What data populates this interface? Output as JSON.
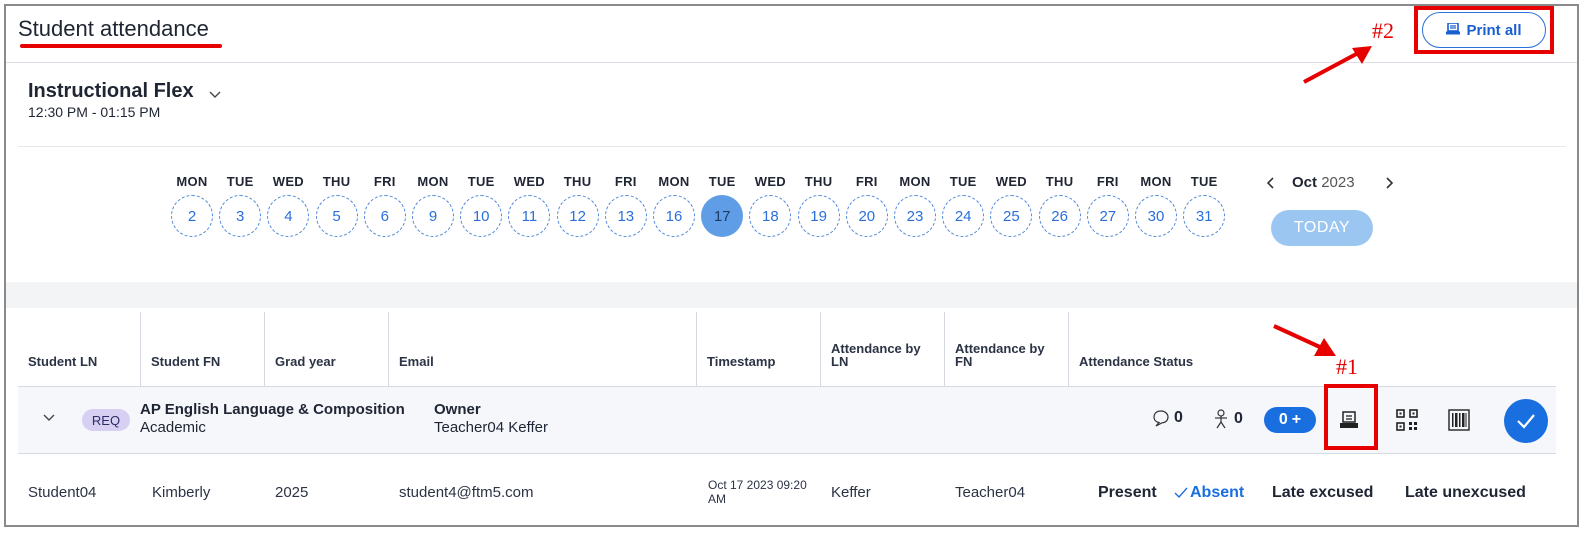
{
  "header": {
    "title": "Student attendance",
    "print_all_label": "Print all"
  },
  "annotations": {
    "one": "#1",
    "two": "#2"
  },
  "section": {
    "title": "Instructional Flex",
    "time": "12:30 PM - 01:15 PM"
  },
  "calendar": {
    "days": [
      {
        "name": "MON",
        "num": "2"
      },
      {
        "name": "TUE",
        "num": "3"
      },
      {
        "name": "WED",
        "num": "4"
      },
      {
        "name": "THU",
        "num": "5"
      },
      {
        "name": "FRI",
        "num": "6"
      },
      {
        "name": "MON",
        "num": "9"
      },
      {
        "name": "TUE",
        "num": "10"
      },
      {
        "name": "WED",
        "num": "11"
      },
      {
        "name": "THU",
        "num": "12"
      },
      {
        "name": "FRI",
        "num": "13"
      },
      {
        "name": "MON",
        "num": "16"
      },
      {
        "name": "TUE",
        "num": "17"
      },
      {
        "name": "WED",
        "num": "18"
      },
      {
        "name": "THU",
        "num": "19"
      },
      {
        "name": "FRI",
        "num": "20"
      },
      {
        "name": "MON",
        "num": "23"
      },
      {
        "name": "TUE",
        "num": "24"
      },
      {
        "name": "WED",
        "num": "25"
      },
      {
        "name": "THU",
        "num": "26"
      },
      {
        "name": "FRI",
        "num": "27"
      },
      {
        "name": "MON",
        "num": "30"
      },
      {
        "name": "TUE",
        "num": "31"
      }
    ],
    "selected_index": 11,
    "month": "Oct",
    "year": "2023",
    "today_label": "TODAY"
  },
  "table": {
    "headers": {
      "student_ln": "Student LN",
      "student_fn": "Student FN",
      "grad_year": "Grad year",
      "email": "Email",
      "timestamp": "Timestamp",
      "att_by_ln": "Attendance by LN",
      "att_by_fn": "Attendance by FN",
      "att_status": "Attendance Status"
    },
    "group": {
      "badge": "REQ",
      "course": "AP English Language & Composition",
      "category": "Academic",
      "owner_label": "Owner",
      "owner_name": "Teacher04 Keffer",
      "comments_count": "0",
      "people_count": "0",
      "add_count": "0"
    },
    "rows": [
      {
        "student_ln": "Student04",
        "student_fn": "Kimberly",
        "grad_year": "2025",
        "email": "student4@ftm5.com",
        "timestamp": "Oct 17 2023 09:20 AM",
        "att_by_ln": "Keffer",
        "att_by_fn": "Teacher04",
        "statuses": [
          "Present",
          "Absent",
          "Late excused",
          "Late unexcused"
        ],
        "active_status": "Absent"
      }
    ]
  },
  "colors": {
    "accent": "#1a6fe0",
    "annotation": "#e60000",
    "selected_day": "#5f9ee6",
    "today_button": "#9cc6f2",
    "badge": "#d8d0f3"
  }
}
